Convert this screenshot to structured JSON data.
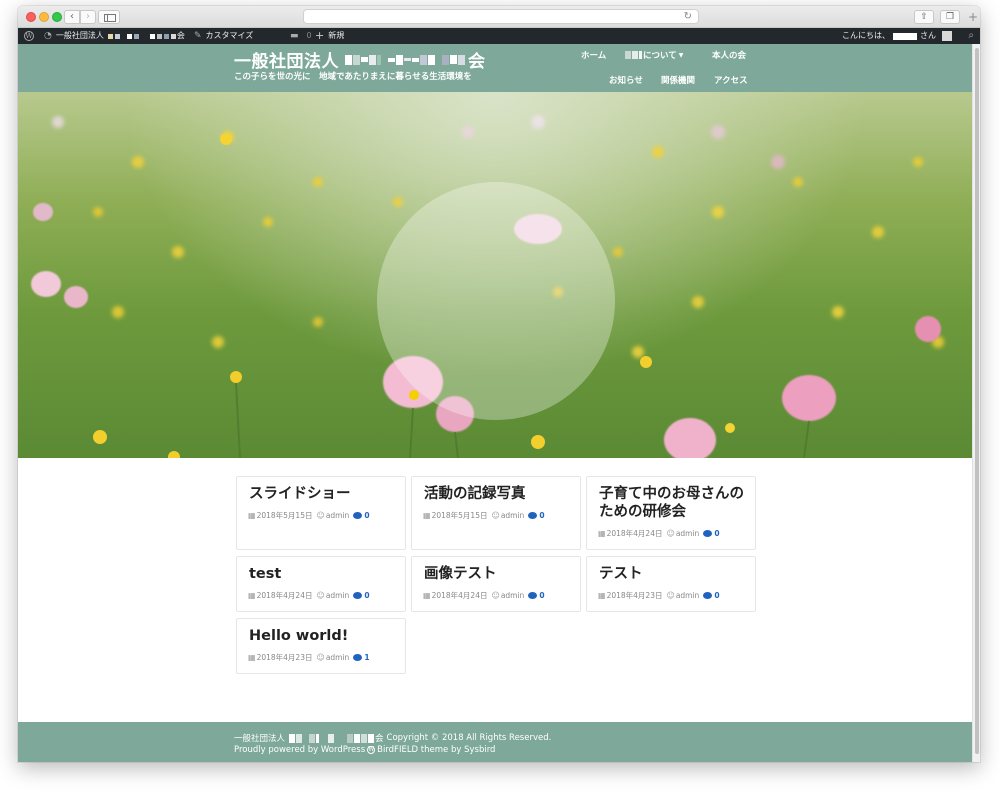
{
  "adminbar": {
    "site_name": "一般社団法人",
    "site_name_end": "会",
    "customize": "カスタマイズ",
    "comments_count": "0",
    "new": "新規",
    "howdy_prefix": "こんにちは、",
    "howdy_suffix": "さん"
  },
  "site": {
    "title_prefix": "一般社団法人",
    "title_suffix": "会",
    "tagline": "この子らを世の光に　地域であたりまえに暮らせる生活環境を"
  },
  "nav": {
    "home": "ホーム",
    "about": "について",
    "person": "本人の会",
    "news": "お知らせ",
    "orgs": "関係機関",
    "access": "アクセス"
  },
  "posts": [
    {
      "title": "スライドショー",
      "date": "2018年5月15日",
      "author": "admin",
      "comments": "0"
    },
    {
      "title": "活動の記録写真",
      "date": "2018年5月15日",
      "author": "admin",
      "comments": "0"
    },
    {
      "title": "子育て中のお母さんのための研修会",
      "date": "2018年4月24日",
      "author": "admin",
      "comments": "0"
    },
    {
      "title": "test",
      "date": "2018年4月24日",
      "author": "admin",
      "comments": "0"
    },
    {
      "title": "画像テスト",
      "date": "2018年4月24日",
      "author": "admin",
      "comments": "0"
    },
    {
      "title": "テスト",
      "date": "2018年4月23日",
      "author": "admin",
      "comments": "0"
    },
    {
      "title": "Hello world!",
      "date": "2018年4月23日",
      "author": "admin",
      "comments": "1"
    }
  ],
  "footer": {
    "org_prefix": "一般社団法人",
    "org_suffix": "会",
    "copyright": "Copyright © 2018 All Rights Reserved.",
    "powered_prefix": "Proudly powered by WordPress",
    "theme": "BirdFIELD theme by Sysbird"
  },
  "colors": {
    "header_bg": "#7da89a",
    "adminbar_bg": "#23282d",
    "comment_accent": "#2062c0"
  },
  "icons": {
    "calendar": "calendar-icon",
    "author": "user-icon",
    "comments": "comment-bubble-icon",
    "search": "search-icon"
  }
}
